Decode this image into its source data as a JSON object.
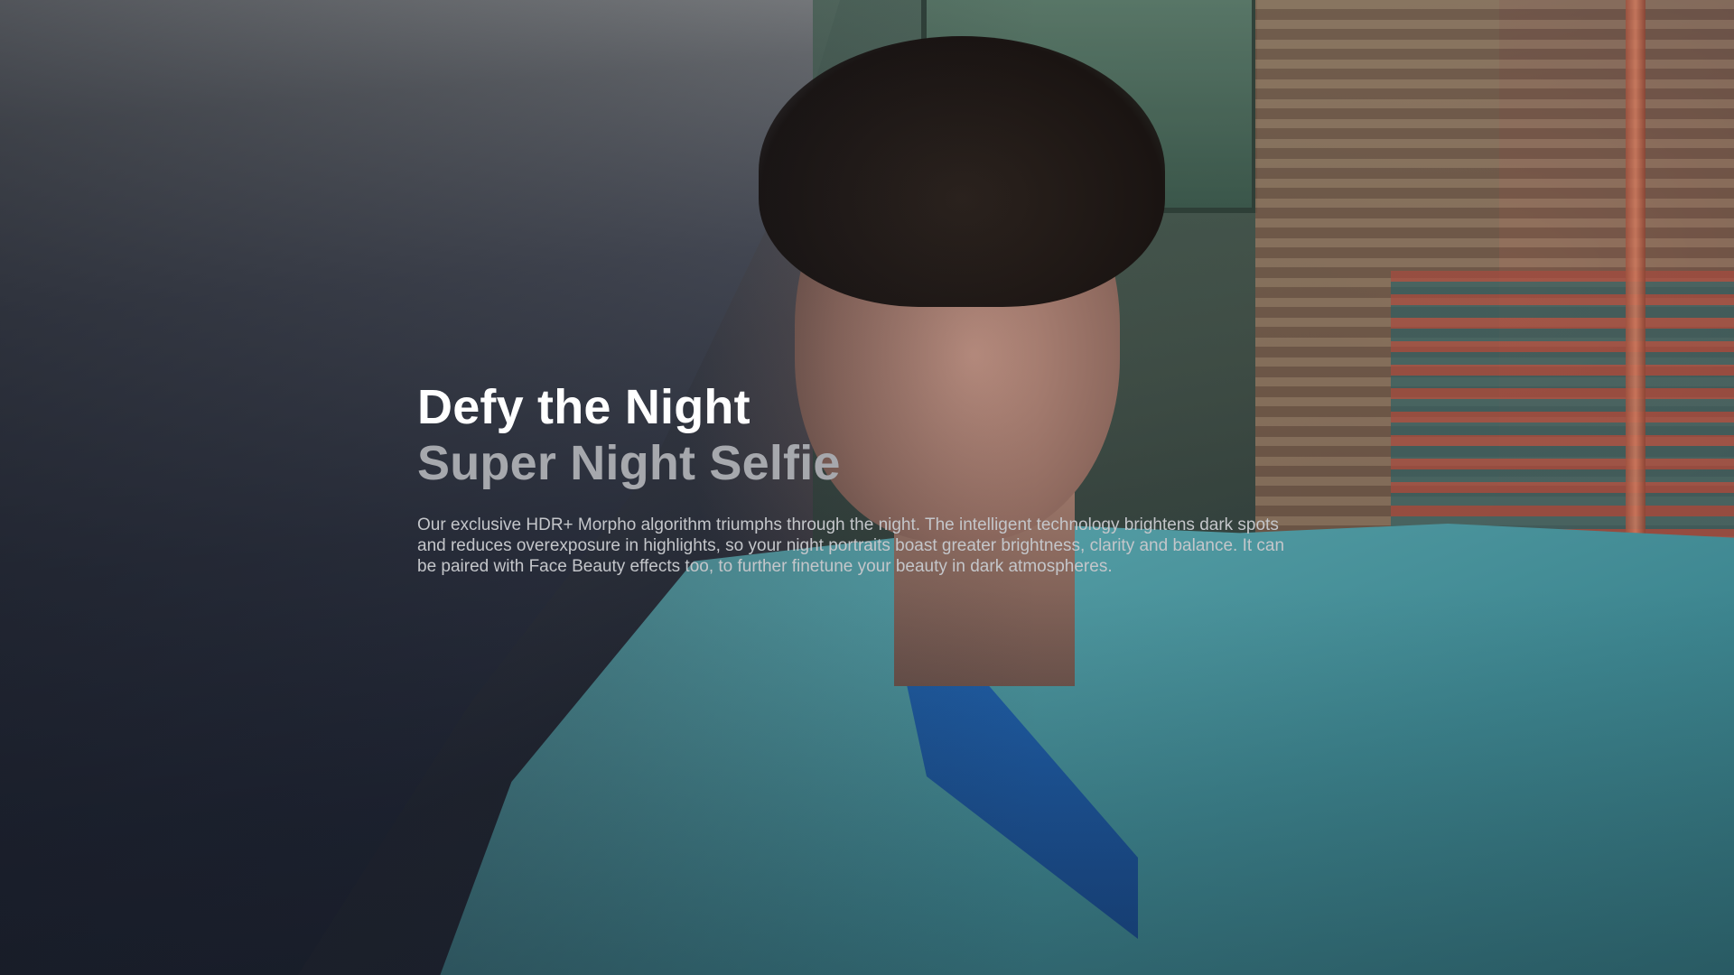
{
  "hero": {
    "title": "Defy the Night",
    "subtitle": "Super Night Selfie",
    "description": "Our exclusive HDR+ Morpho algorithm triumphs through the night. The intelligent technology brightens dark spots and reduces overexposure in highlights, so your night portraits boast greater brightness, clarity and balance. It can be paired with Face Beauty effects too, to further finetune your beauty in dark atmospheres."
  },
  "colors": {
    "title": "#ffffff",
    "subtitle": "#a6a8ad",
    "description": "#c4c6ca",
    "jacket": "#4f98a0",
    "collar": "#1f5fa8"
  }
}
